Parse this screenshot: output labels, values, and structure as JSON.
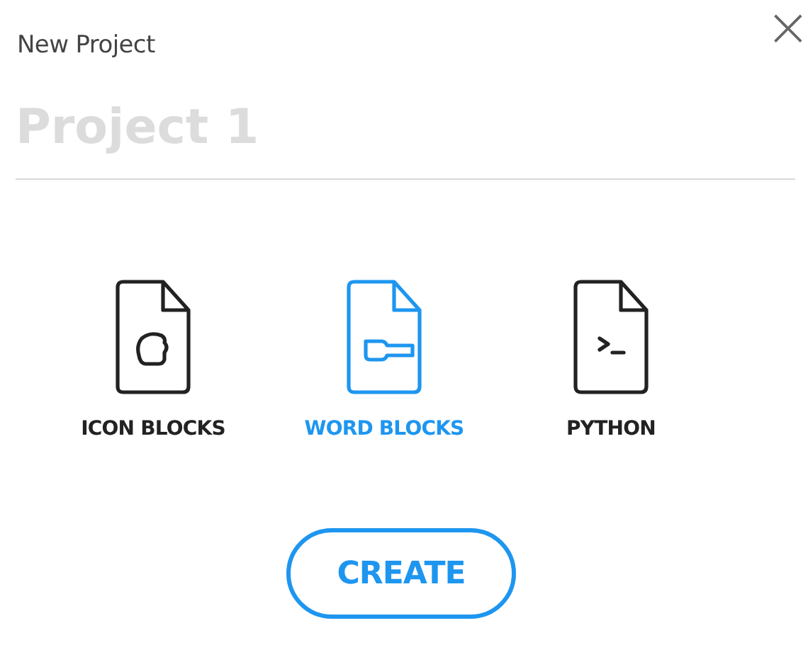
{
  "dialog": {
    "title": "New Project",
    "close": "×"
  },
  "name_field": {
    "placeholder": "Project 1"
  },
  "project_types": [
    {
      "kind": "icon",
      "label": "ICON BLOCKS",
      "selected": false
    },
    {
      "kind": "word",
      "label": "WORD BLOCKS",
      "selected": true
    },
    {
      "kind": "python",
      "label": "PYTHON",
      "selected": false
    }
  ],
  "buttons": [
    "CREATE"
  ]
}
